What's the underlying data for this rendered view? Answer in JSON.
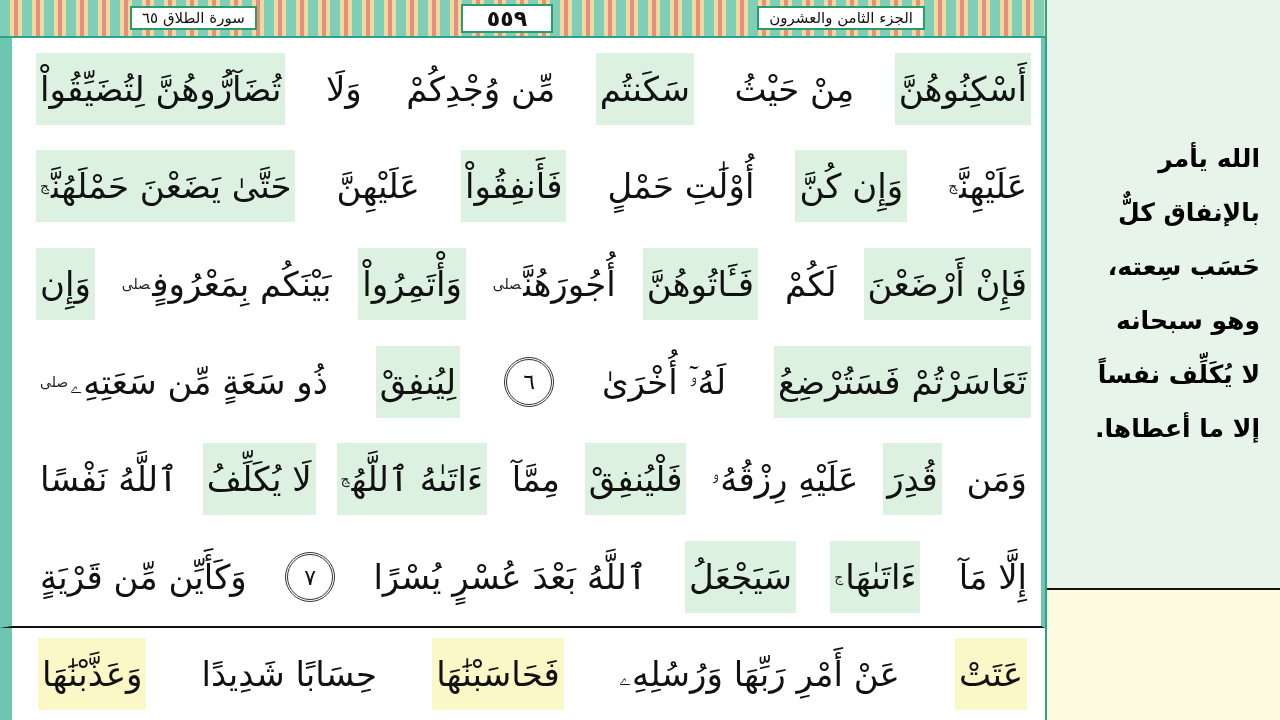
{
  "header": {
    "juz": "الجزء الثامن والعشرون",
    "page_number": "٥٥٩",
    "surah": "سورة الطلاق ٦٥"
  },
  "blocks": [
    {
      "color": "#ddf1e1",
      "lines": [
        {
          "segments": [
            {
              "kind": "words",
              "text": "أَسْكِنُوهُنَّ",
              "highlighted": true
            },
            {
              "kind": "words",
              "text": "مِنْ حَيْثُ",
              "highlighted": false
            },
            {
              "kind": "words",
              "text": "سَكَنتُم",
              "highlighted": true
            },
            {
              "kind": "words",
              "text": "مِّن وُجْدِكُمْ",
              "highlighted": false
            },
            {
              "kind": "words",
              "text": "وَلَا",
              "highlighted": false
            },
            {
              "kind": "words",
              "text": "تُضَآرُّوهُنَّ لِتُضَيِّقُواْ",
              "highlighted": true
            }
          ]
        },
        {
          "segments": [
            {
              "kind": "words",
              "text": "عَلَيْهِنَّ",
              "pause": "ج",
              "highlighted": false
            },
            {
              "kind": "words",
              "text": "وَإِن كُنَّ",
              "highlighted": true
            },
            {
              "kind": "words",
              "text": "أُوْلَٰتِ حَمْلٍ",
              "highlighted": false
            },
            {
              "kind": "words",
              "text": "فَأَنفِقُواْ",
              "highlighted": true
            },
            {
              "kind": "words",
              "text": "عَلَيْهِنَّ",
              "highlighted": false
            },
            {
              "kind": "words",
              "text": "حَتَّىٰ يَضَعْنَ حَمْلَهُنَّ",
              "pause": "ج",
              "highlighted": true
            }
          ]
        },
        {
          "segments": [
            {
              "kind": "words",
              "text": "فَإِنْ أَرْضَعْنَ",
              "highlighted": true
            },
            {
              "kind": "words",
              "text": "لَكُمْ",
              "highlighted": false
            },
            {
              "kind": "words",
              "text": "فَـَٔاتُوهُنَّ",
              "highlighted": true
            },
            {
              "kind": "words",
              "text": "أُجُورَهُنَّ",
              "pause": "صلى",
              "highlighted": false
            },
            {
              "kind": "words",
              "text": "وَأْتَمِرُواْ",
              "highlighted": true
            },
            {
              "kind": "words",
              "text": "بَيْنَكُم بِمَعْرُوفٍ",
              "pause": "صلى",
              "highlighted": false
            },
            {
              "kind": "words",
              "text": "وَإِن",
              "highlighted": true
            }
          ]
        },
        {
          "segments": [
            {
              "kind": "words",
              "text": "تَعَاسَرْتُمْ فَسَتُرْضِعُ",
              "highlighted": true
            },
            {
              "kind": "words",
              "text": "لَهُۥٓ أُخْرَىٰ",
              "highlighted": false
            },
            {
              "kind": "verse-number",
              "text": "٦"
            },
            {
              "kind": "words",
              "text": "لِيُنفِقْ",
              "highlighted": true
            },
            {
              "kind": "words",
              "text": "ذُو سَعَةٍ مِّن سَعَتِهِۦ",
              "pause": "صلى",
              "highlighted": false
            }
          ]
        },
        {
          "segments": [
            {
              "kind": "words",
              "text": "وَمَن",
              "highlighted": false
            },
            {
              "kind": "words",
              "text": "قُدِرَ",
              "highlighted": true
            },
            {
              "kind": "words",
              "text": "عَلَيْهِ رِزْقُهُۥ",
              "highlighted": false
            },
            {
              "kind": "words",
              "text": "فَلْيُنفِقْ",
              "highlighted": true
            },
            {
              "kind": "words",
              "text": "مِمَّآ",
              "highlighted": false
            },
            {
              "kind": "words",
              "text": "ءَاتَىٰهُ ٱللَّهُ",
              "pause": "ج",
              "highlighted": true
            },
            {
              "kind": "words",
              "text": "لَا يُكَلِّفُ",
              "highlighted": true
            },
            {
              "kind": "words",
              "text": "ٱللَّهُ نَفْسًا",
              "highlighted": false
            }
          ]
        },
        {
          "segments": [
            {
              "kind": "words",
              "text": "إِلَّا مَآ",
              "highlighted": false
            },
            {
              "kind": "words",
              "text": "ءَاتَىٰهَا",
              "pause": "ج",
              "highlighted": true
            },
            {
              "kind": "words",
              "text": "سَيَجْعَلُ",
              "highlighted": true
            },
            {
              "kind": "words",
              "text": "ٱللَّهُ بَعْدَ عُسْرٍ يُسْرًا",
              "highlighted": false
            },
            {
              "kind": "verse-number",
              "text": "٧"
            },
            {
              "kind": "words",
              "text": "وَكَأَيِّن مِّن قَرْيَةٍ",
              "highlighted": false
            }
          ]
        }
      ]
    },
    {
      "color": "#fbf7c6",
      "lines": [
        {
          "segments": [
            {
              "kind": "words",
              "text": "عَتَتْ",
              "highlighted": true
            },
            {
              "kind": "words",
              "text": "عَنْ أَمْرِ رَبِّهَا وَرُسُلِهِۦ",
              "highlighted": false
            },
            {
              "kind": "words",
              "text": "فَحَاسَبْنَٰهَا",
              "highlighted": true
            },
            {
              "kind": "words",
              "text": "حِسَابًا شَدِيدًا",
              "highlighted": false
            },
            {
              "kind": "words",
              "text": "وَعَذَّبْنَٰهَا",
              "highlighted": true
            }
          ]
        }
      ]
    }
  ],
  "note": {
    "lines": [
      "الله يأمر",
      "بالإنفاق كلٌّ",
      "حَسَب سِعته،",
      "وهو سبحانه",
      "لا يُكَلِّف نفساً",
      "إلا ما أعطاها."
    ]
  }
}
